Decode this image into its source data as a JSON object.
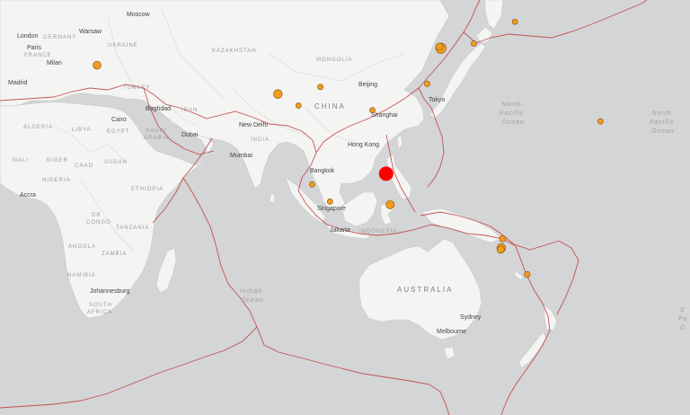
{
  "cities": [
    {
      "name": "Moscow"
    },
    {
      "name": "London"
    },
    {
      "name": "Warsaw"
    },
    {
      "name": "Paris"
    },
    {
      "name": "Milan"
    },
    {
      "name": "Madrid"
    },
    {
      "name": "Cairo"
    },
    {
      "name": "Baghdad"
    },
    {
      "name": "Dubai"
    },
    {
      "name": "New Delhi"
    },
    {
      "name": "Mumbai"
    },
    {
      "name": "Beijing"
    },
    {
      "name": "Shanghai"
    },
    {
      "name": "Tokyo"
    },
    {
      "name": "Hong Kong"
    },
    {
      "name": "Bangkok"
    },
    {
      "name": "Singapore"
    },
    {
      "name": "Jakarta"
    },
    {
      "name": "Accra"
    },
    {
      "name": "Johannesburg"
    },
    {
      "name": "Sydney"
    },
    {
      "name": "Melbourne"
    }
  ],
  "countries": [
    {
      "name": "GERMANY"
    },
    {
      "name": "UKRAINE"
    },
    {
      "name": "KAZAKHSTAN"
    },
    {
      "name": "MONGOLIA"
    },
    {
      "name": "FRANCE"
    },
    {
      "name": "TURKEY"
    },
    {
      "name": "ALGERIA"
    },
    {
      "name": "LIBYA"
    },
    {
      "name": "EGYPT"
    },
    {
      "name": "IRAN"
    },
    {
      "name": "SAUDI"
    },
    {
      "name": "ARABIA"
    },
    {
      "name": "INDIA"
    },
    {
      "name": "CHINA"
    },
    {
      "name": "MALI"
    },
    {
      "name": "NIGER"
    },
    {
      "name": "CHAD"
    },
    {
      "name": "SUDAN"
    },
    {
      "name": "NIGERIA"
    },
    {
      "name": "ETHIOPIA"
    },
    {
      "name": "DR"
    },
    {
      "name": "CONGO"
    },
    {
      "name": "TANZANIA"
    },
    {
      "name": "ANGOLA"
    },
    {
      "name": "ZAMBIA"
    },
    {
      "name": "NAMIBIA"
    },
    {
      "name": "SOUTH"
    },
    {
      "name": "AFRICA"
    },
    {
      "name": "INDONESIA"
    },
    {
      "name": "AUSTRALIA"
    }
  ],
  "oceans": [
    {
      "lines": [
        "Indian",
        "Ocean"
      ]
    },
    {
      "lines": [
        "North",
        "Pacific",
        "Ocean"
      ]
    },
    {
      "lines": [
        "North",
        "Pacific",
        "Ocean"
      ]
    },
    {
      "lines": [
        "S",
        "Pa",
        "O"
      ]
    }
  ],
  "earthquakes": [
    {
      "lat": 37.5,
      "lon": 21.0,
      "mag": 5.6
    },
    {
      "lat": 28.2,
      "lon": 87.0,
      "mag": 5.8
    },
    {
      "lat": 24.5,
      "lon": 94.5,
      "mag": 4.9
    },
    {
      "lat": 30.5,
      "lon": 102.5,
      "mag": 5.0
    },
    {
      "lat": 23.0,
      "lon": 121.5,
      "mag": 4.7
    },
    {
      "lat": 31.5,
      "lon": 141.5,
      "mag": 5.0
    },
    {
      "lat": 43.0,
      "lon": 146.5,
      "mag": 6.2
    },
    {
      "lat": 43.5,
      "lon": 146.0,
      "mag": 5.4
    },
    {
      "lat": 44.5,
      "lon": 158.5,
      "mag": 4.8
    },
    {
      "lat": 51.5,
      "lon": 173.5,
      "mag": 4.6
    },
    {
      "lat": 19.4,
      "lon": -155.3,
      "mag": 4.8
    },
    {
      "lat": -1.0,
      "lon": 99.5,
      "mag": 4.9
    },
    {
      "lat": -6.5,
      "lon": 106.0,
      "mag": 4.9
    },
    {
      "lat": -7.5,
      "lon": 128.0,
      "mag": 5.7
    },
    {
      "lat": -18.5,
      "lon": 169.0,
      "mag": 5.2
    },
    {
      "lat": -21.5,
      "lon": 168.5,
      "mag": 5.8
    },
    {
      "lat": -22.0,
      "lon": 168.3,
      "mag": 5.4
    },
    {
      "lat": -30.0,
      "lon": 178.0,
      "mag": 5.1
    }
  ],
  "selected_earthquake": {
    "lat": 2.5,
    "lon": 126.5
  },
  "colors": {
    "ocean": "#d4d5d6",
    "land": "#f4f4f3",
    "plate_boundary": "#c0393b",
    "quake": "#f39c1f",
    "selected_quake": "#ff0000"
  }
}
